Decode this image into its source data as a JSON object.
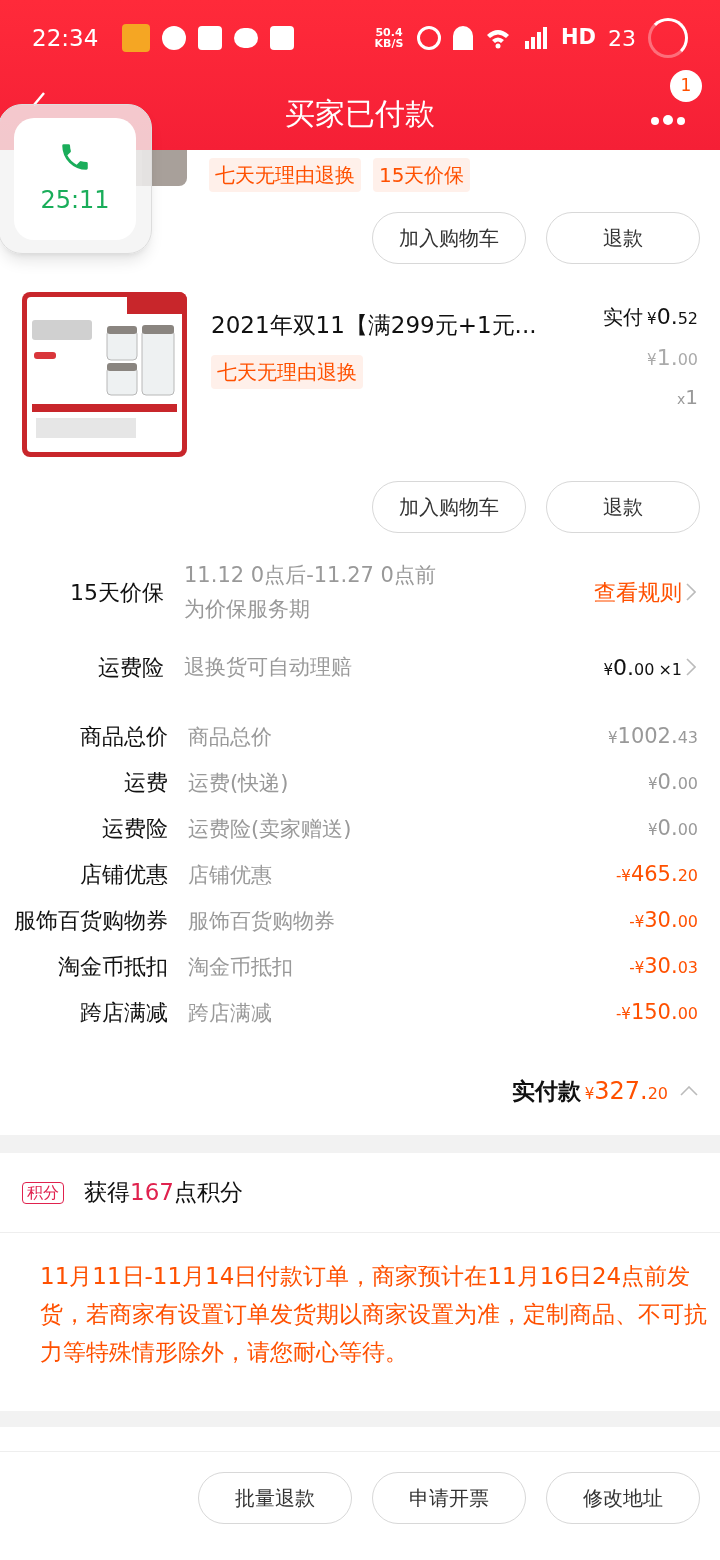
{
  "status_bar": {
    "time": "22:34",
    "net_speed": "50.4 KB/S",
    "hd": "HD",
    "battery": "23"
  },
  "header": {
    "title": "买家已付款",
    "badge": "1"
  },
  "call_widget": {
    "duration": "25:11"
  },
  "items": [
    {
      "kind": "partial",
      "tags": [
        "七天无理由退换",
        "15天价保"
      ],
      "buttons": [
        "加入购物车",
        "退款"
      ]
    },
    {
      "kind": "full",
      "title": "2021年双11【满299元+1元...",
      "paid_label": "实付",
      "paid_prefix": "¥",
      "paid_main": "0.",
      "paid_cents": "52",
      "price_prefix": "¥",
      "price_main": "1.",
      "price_cents": "00",
      "qty_prefix": "x",
      "qty": "1",
      "tags": [
        "七天无理由退换"
      ],
      "buttons": [
        "加入购物车",
        "退款"
      ]
    }
  ],
  "services": [
    {
      "label": "15天价保",
      "desc": [
        "11.12 0点后-11.27 0点前",
        "为价保服务期"
      ],
      "action": "查看规则"
    },
    {
      "label": "运费险",
      "desc": [
        "退换货可自动理赔"
      ],
      "prefix": "¥",
      "main": "0.",
      "cents": "00",
      "qty": "×1"
    }
  ],
  "price_rows": [
    {
      "label": "商品总价",
      "desc": "商品总价",
      "discount": false,
      "prefix": "¥",
      "main": "1002.",
      "cents": "43"
    },
    {
      "label": "运费",
      "desc": "运费(快递)",
      "discount": false,
      "prefix": "¥",
      "main": "0.",
      "cents": "00"
    },
    {
      "label": "运费险",
      "desc": "运费险(卖家赠送)",
      "discount": false,
      "prefix": "¥",
      "main": "0.",
      "cents": "00"
    },
    {
      "label": "店铺优惠",
      "desc": "店铺优惠",
      "discount": true,
      "prefix": "-¥",
      "main": "465.",
      "cents": "20"
    },
    {
      "label": "服饰百货购物券",
      "desc": "服饰百货购物券",
      "discount": true,
      "prefix": "-¥",
      "main": "30.",
      "cents": "00"
    },
    {
      "label": "淘金币抵扣",
      "desc": "淘金币抵扣",
      "discount": true,
      "prefix": "-¥",
      "main": "30.",
      "cents": "03"
    },
    {
      "label": "跨店满减",
      "desc": "跨店满减",
      "discount": true,
      "prefix": "-¥",
      "main": "150.",
      "cents": "00"
    }
  ],
  "total": {
    "label": "实付款",
    "prefix": "¥",
    "main": "327.",
    "cents": "20",
    "expanded": true
  },
  "points": {
    "badge": "积分",
    "before": "获得",
    "count": "167",
    "after": "点积分"
  },
  "notice": "11月11日-11月14日付款订单，商家预计在11月16日24点前发货，若商家有设置订单发货期以商家设置为准，定制商品、不可抗力等特殊情形除外，请您耐心等待。",
  "bottom_buttons": [
    "批量退款",
    "申请开票",
    "修改地址"
  ]
}
